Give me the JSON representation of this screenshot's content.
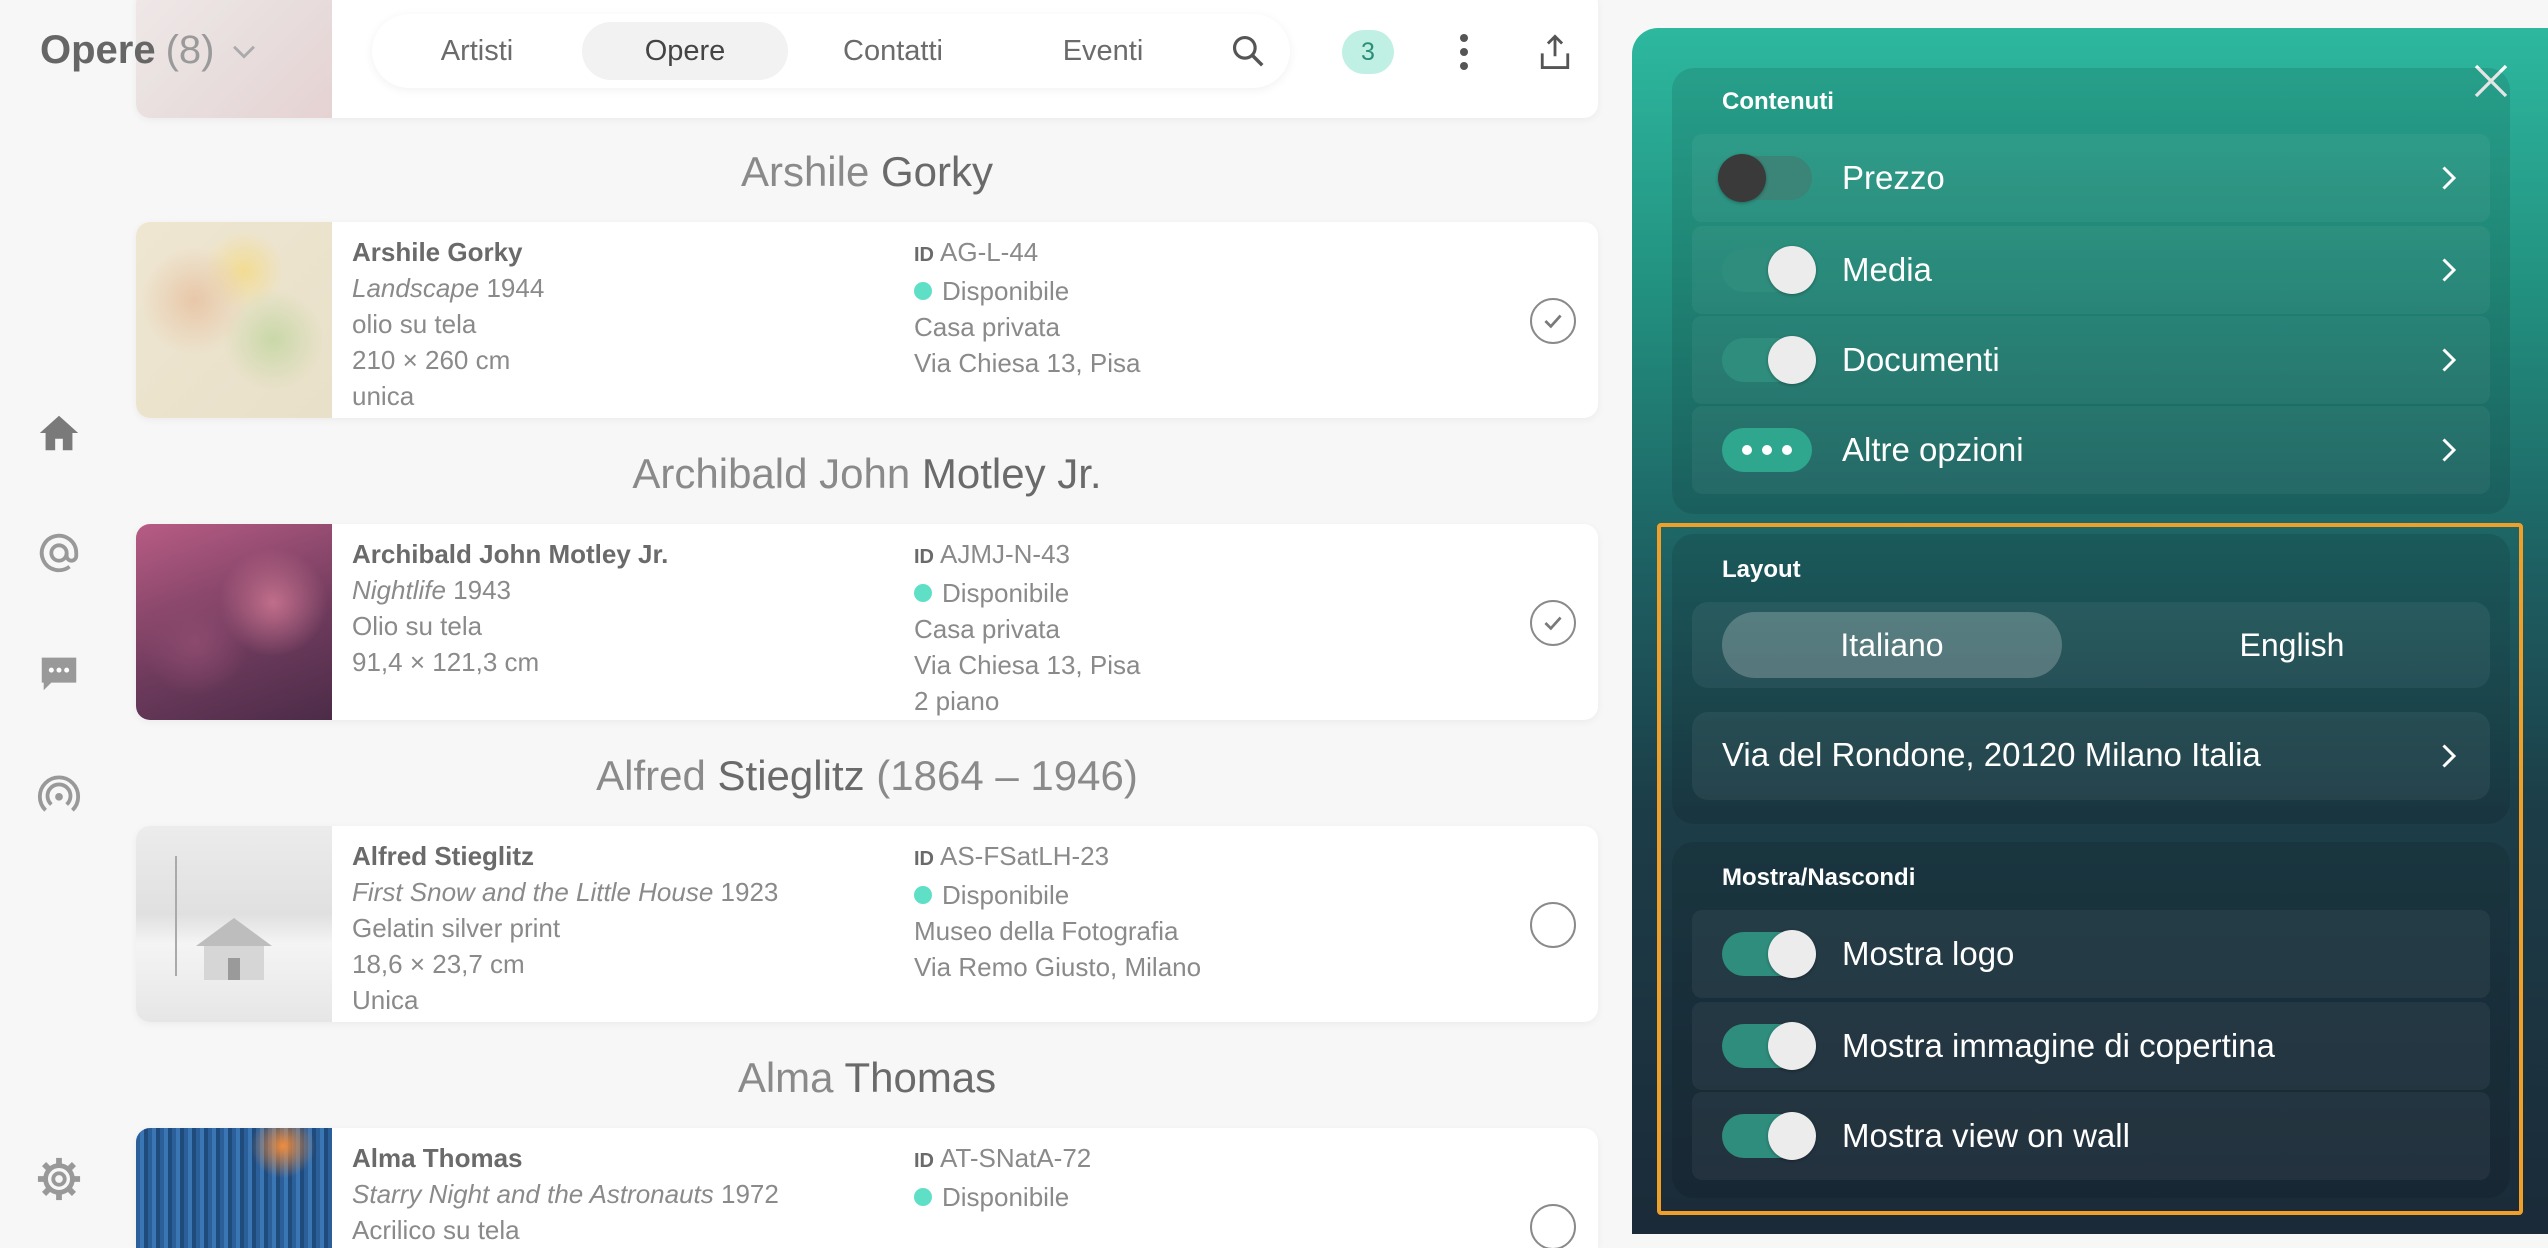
{
  "header": {
    "title": "Opere",
    "count": "(8)",
    "tabs": [
      {
        "label": "Artisti",
        "active": false
      },
      {
        "label": "Opere",
        "active": true
      },
      {
        "label": "Contatti",
        "active": false
      },
      {
        "label": "Eventi",
        "active": false
      }
    ],
    "badge": "3"
  },
  "artworks": [
    {
      "heading_first": "Arshile",
      "heading_last": "Gorky",
      "artist": "Arshile Gorky",
      "title": "Landscape",
      "year": "1944",
      "medium": "olio su tela",
      "dimensions": "210 × 260 cm",
      "edition": "unica",
      "id": "AG-L-44",
      "status": "Disponibile",
      "location": "Casa privata",
      "address": "Via Chiesa 13, Pisa",
      "extra": "",
      "selected": true
    },
    {
      "heading_first": "Archibald John",
      "heading_last": "Motley Jr.",
      "artist": "Archibald John Motley Jr.",
      "title": "Nightlife",
      "year": "1943",
      "medium": "Olio su tela",
      "dimensions": "91,4 × 121,3 cm",
      "edition": "",
      "id": "AJMJ-N-43",
      "status": "Disponibile",
      "location": "Casa privata",
      "address": "Via Chiesa 13, Pisa",
      "extra": "2 piano",
      "selected": true
    },
    {
      "heading_first": "Alfred",
      "heading_last": "Stieglitz",
      "heading_years": "(1864 – 1946)",
      "artist": "Alfred Stieglitz",
      "title": "First Snow and the Little House",
      "year": "1923",
      "medium": "Gelatin silver print",
      "dimensions": "18,6 × 23,7 cm",
      "edition": "Unica",
      "id": "AS-FSatLH-23",
      "status": "Disponibile",
      "location": "Museo della Fotografia",
      "address": "Via Remo Giusto, Milano",
      "extra": "",
      "selected": false
    },
    {
      "heading_first": "Alma",
      "heading_last": "Thomas",
      "artist": "Alma Thomas",
      "title": "Starry Night and the Astronauts",
      "year": "1972",
      "medium": "Acrilico su tela",
      "dimensions": "",
      "edition": "",
      "id": "AT-SNatA-72",
      "status": "Disponibile",
      "location": "",
      "address": "",
      "extra": "",
      "selected": false
    }
  ],
  "id_label": "ID",
  "panel": {
    "contenuti": {
      "title": "Contenuti",
      "items": [
        {
          "label": "Prezzo",
          "toggle": "off"
        },
        {
          "label": "Media",
          "toggle": "on"
        },
        {
          "label": "Documenti",
          "toggle": "on"
        },
        {
          "label": "Altre opzioni",
          "toggle": "dots"
        }
      ]
    },
    "layout": {
      "title": "Layout",
      "languages": [
        {
          "label": "Italiano",
          "active": true
        },
        {
          "label": "English",
          "active": false
        }
      ],
      "address": "Via del Rondone, 20120 Milano Italia"
    },
    "mostra": {
      "title": "Mostra/Nascondi",
      "items": [
        {
          "label": "Mostra logo",
          "toggle": "on"
        },
        {
          "label": "Mostra immagine di copertina",
          "toggle": "on"
        },
        {
          "label": "Mostra view on wall",
          "toggle": "on"
        }
      ]
    }
  },
  "colors": {
    "accent": "#2db89f",
    "status_available": "#5fe0c6",
    "highlight": "#f0a028"
  },
  "icons": {
    "rail": [
      "home-icon",
      "at-icon",
      "chat-icon",
      "broadcast-icon",
      "settings-gear-icon"
    ]
  }
}
